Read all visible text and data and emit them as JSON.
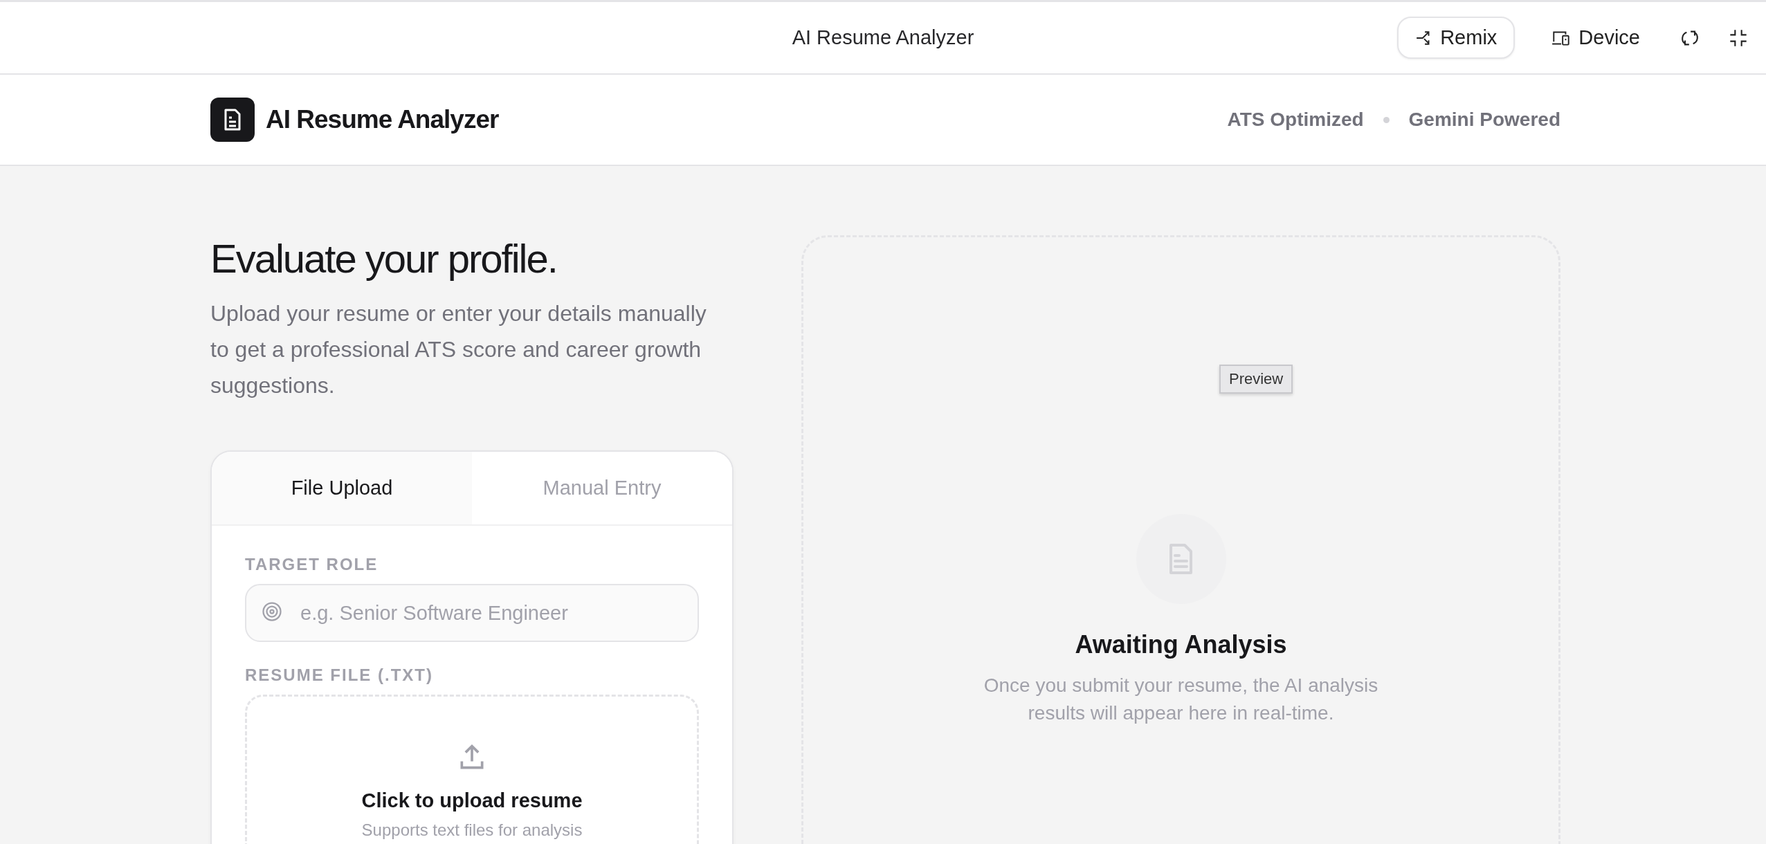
{
  "toolbar": {
    "title": "AI Resume Analyzer",
    "buttons": [
      {
        "kind": "remix",
        "label": "Remix"
      },
      {
        "kind": "device",
        "label": "Device"
      }
    ],
    "icons": [
      {
        "kind": "refresh"
      },
      {
        "kind": "collapse"
      }
    ]
  },
  "header": {
    "brand": "AI Resume Analyzer",
    "badges": [
      "ATS Optimized",
      "Gemini Powered"
    ]
  },
  "intro": {
    "heading": "Evaluate your profile.",
    "text": "Upload your resume or enter your details manually to get a professional ATS score and career growth suggestions."
  },
  "form": {
    "tabs": [
      {
        "label": "File Upload",
        "selected": true
      },
      {
        "label": "Manual Entry",
        "selected": false
      }
    ],
    "target_role": {
      "label": "TARGET ROLE",
      "placeholder": "e.g. Senior Software Engineer"
    },
    "resume_file": {
      "label": "RESUME FILE (.TXT)",
      "title": "Click to upload resume",
      "hint": "Supports text files for analysis"
    }
  },
  "results": {
    "tooltip": "Preview",
    "title": "Awaiting Analysis",
    "text": "Once you submit your resume, the AI analysis results will appear here in real-time."
  }
}
